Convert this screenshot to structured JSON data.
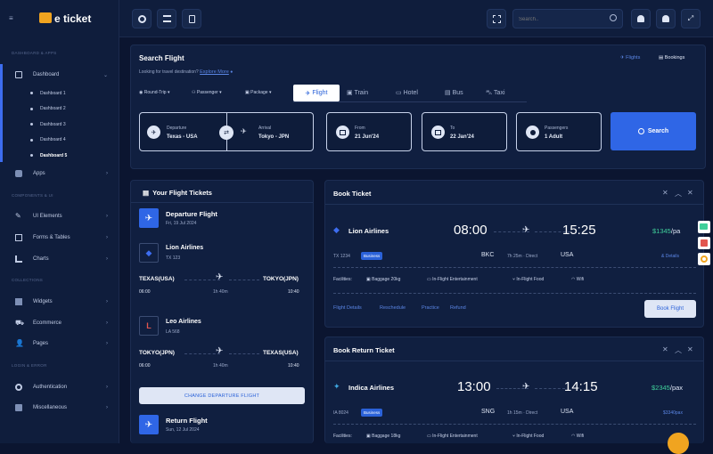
{
  "brand": {
    "name": "e ticket"
  },
  "sidebar": {
    "section1": "DASHBOARD & APPS",
    "dashboard": "Dashboard",
    "subs": [
      "Dashboard 1",
      "Dashboard 2",
      "Dashboard 3",
      "Dashboard 4",
      "Dashboard 5"
    ],
    "apps": "Apps",
    "section2": "COMPONENTS & UI",
    "ui": "UI Elements",
    "forms": "Forms & Tables",
    "charts": "Charts",
    "section3": "COLLECTIONS",
    "widgets": "Widgets",
    "ecommerce": "Ecommerce",
    "pages": "Pages",
    "section4": "LOGIN & ERROR",
    "auth": "Authentication",
    "misc": "Miscellaneous"
  },
  "topbar": {
    "search_placeholder": "Search.."
  },
  "search": {
    "title": "Search Flight",
    "subtitle": "Looking for travel destination?",
    "explore": "Explore More",
    "flights_link": "Flights",
    "bookings_link": "Bookings",
    "trip": "Round-Trip",
    "passenger": "Passenger",
    "package": "Package",
    "tabs": [
      "Flight",
      "Train",
      "Hotel",
      "Bus",
      "Taxi"
    ],
    "departure_label": "Departure",
    "departure_value": "Texas - USA",
    "arrival_label": "Arrival",
    "arrival_value": "Tokyo - JPN",
    "from_label": "From",
    "from_value": "21 Jun'24",
    "to_label": "To",
    "to_value": "22 Jan'24",
    "pass_label": "Passengers",
    "pass_value": "1 Adult",
    "button": "Search"
  },
  "tickets": {
    "title": "Your Flight Tickets",
    "dep_title": "Departure Flight",
    "dep_date": "Fri, 19 Jul 2024",
    "air1": "Lion Airlines",
    "code1": "TX 123",
    "from1": "TEXAS(USA)",
    "to1": "TOKYO(JPN)",
    "t1a": "06:00",
    "dur1": "1h 40m",
    "t1b": "10:40",
    "air2": "Leo Airlines",
    "code2": "LA 568",
    "from2": "TOKYO(JPN)",
    "to2": "TEXAS(USA)",
    "t2a": "06:00",
    "dur2": "1h 40m",
    "t2b": "10:40",
    "change": "CHANGE DEPARTURE FLIGHT",
    "ret_title": "Return Flight",
    "ret_date": "Sun, 12 Jul 2024"
  },
  "book": {
    "title": "Book Ticket",
    "airline": "Lion Airlines",
    "dep": "08:00",
    "arr": "15:25",
    "price": "$1345",
    "per": "/pa",
    "code": "TX 1234",
    "badge": "Business",
    "from": "BKC",
    "info": "7h 25m · Direct",
    "to": "USA",
    "seats": "& Details",
    "fac_label": "Facilities:",
    "fac": [
      "Baggage 20kg",
      "In-Flight Entertainment",
      "In-Flight Food",
      "Wifi"
    ],
    "links": [
      "Flight Details",
      "Reschedule",
      "Practice",
      "Refund"
    ],
    "button": "Book Flight"
  },
  "ret": {
    "title": "Book Return Ticket",
    "airline": "Indica Airlines",
    "dep": "13:00",
    "arr": "14:15",
    "price": "$2345",
    "per": "/pax",
    "code": "IA 8024",
    "badge": "Business",
    "from": "SNG",
    "info": "1h 15m · Direct",
    "to": "USA",
    "seats": "$3340pax",
    "fac_label": "Facilities:",
    "fac": [
      "Baggage 18kg",
      "In-Flight Entertainment",
      "In-Flight Food",
      "Wifi"
    ]
  }
}
